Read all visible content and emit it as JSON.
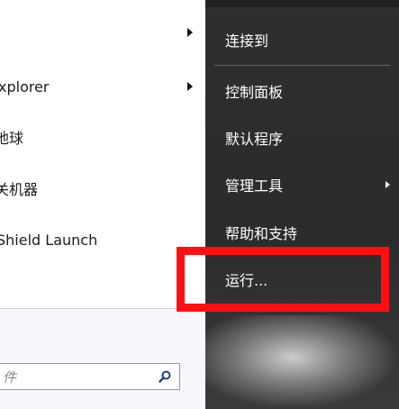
{
  "left_menu": {
    "items": [
      {
        "label": "",
        "has_arrow": true
      },
      {
        "label": "xplorer",
        "has_arrow": true
      },
      {
        "label": "地球",
        "has_arrow": false
      },
      {
        "label": "关机器",
        "has_arrow": false
      },
      {
        "label": "Shield Launch",
        "has_arrow": false
      }
    ],
    "search_placeholder": "件"
  },
  "right_menu": {
    "items": [
      {
        "label": "连接到",
        "has_arrow": false
      },
      {
        "label": "控制面板",
        "has_arrow": false
      },
      {
        "label": "默认程序",
        "has_arrow": false
      },
      {
        "label": "管理工具",
        "has_arrow": true
      },
      {
        "label": "帮助和支持",
        "has_arrow": false
      },
      {
        "label": "运行...",
        "has_arrow": false
      }
    ]
  },
  "colors": {
    "highlight": "#ff0f12",
    "right_pane_bg": "#2f2f2f",
    "left_pane_bg": "#ffffff"
  },
  "icons": {
    "search": "magnifier-icon",
    "submenu": "chevron-right-icon"
  }
}
